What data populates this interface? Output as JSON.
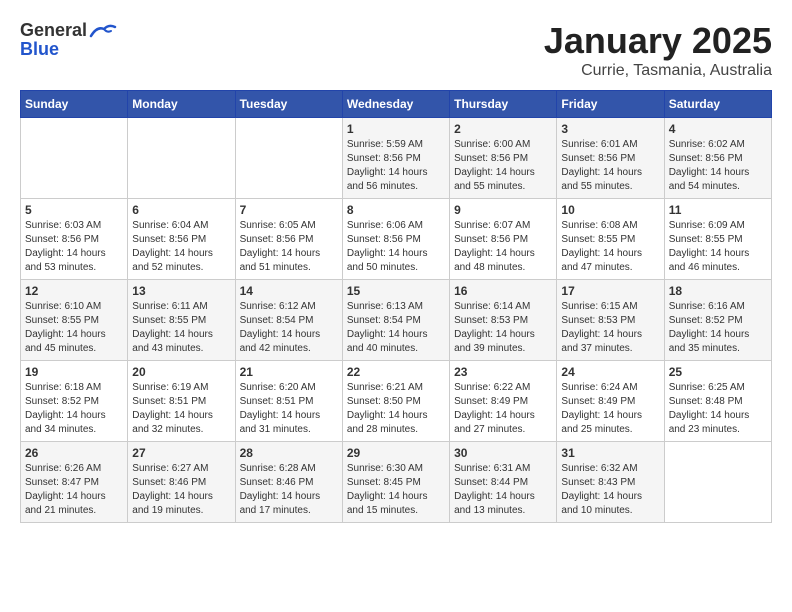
{
  "header": {
    "logo_general": "General",
    "logo_blue": "Blue",
    "title": "January 2025",
    "subtitle": "Currie, Tasmania, Australia"
  },
  "days_of_week": [
    "Sunday",
    "Monday",
    "Tuesday",
    "Wednesday",
    "Thursday",
    "Friday",
    "Saturday"
  ],
  "weeks": [
    [
      {
        "day": "",
        "info": ""
      },
      {
        "day": "",
        "info": ""
      },
      {
        "day": "",
        "info": ""
      },
      {
        "day": "1",
        "info": "Sunrise: 5:59 AM\nSunset: 8:56 PM\nDaylight: 14 hours\nand 56 minutes."
      },
      {
        "day": "2",
        "info": "Sunrise: 6:00 AM\nSunset: 8:56 PM\nDaylight: 14 hours\nand 55 minutes."
      },
      {
        "day": "3",
        "info": "Sunrise: 6:01 AM\nSunset: 8:56 PM\nDaylight: 14 hours\nand 55 minutes."
      },
      {
        "day": "4",
        "info": "Sunrise: 6:02 AM\nSunset: 8:56 PM\nDaylight: 14 hours\nand 54 minutes."
      }
    ],
    [
      {
        "day": "5",
        "info": "Sunrise: 6:03 AM\nSunset: 8:56 PM\nDaylight: 14 hours\nand 53 minutes."
      },
      {
        "day": "6",
        "info": "Sunrise: 6:04 AM\nSunset: 8:56 PM\nDaylight: 14 hours\nand 52 minutes."
      },
      {
        "day": "7",
        "info": "Sunrise: 6:05 AM\nSunset: 8:56 PM\nDaylight: 14 hours\nand 51 minutes."
      },
      {
        "day": "8",
        "info": "Sunrise: 6:06 AM\nSunset: 8:56 PM\nDaylight: 14 hours\nand 50 minutes."
      },
      {
        "day": "9",
        "info": "Sunrise: 6:07 AM\nSunset: 8:56 PM\nDaylight: 14 hours\nand 48 minutes."
      },
      {
        "day": "10",
        "info": "Sunrise: 6:08 AM\nSunset: 8:55 PM\nDaylight: 14 hours\nand 47 minutes."
      },
      {
        "day": "11",
        "info": "Sunrise: 6:09 AM\nSunset: 8:55 PM\nDaylight: 14 hours\nand 46 minutes."
      }
    ],
    [
      {
        "day": "12",
        "info": "Sunrise: 6:10 AM\nSunset: 8:55 PM\nDaylight: 14 hours\nand 45 minutes."
      },
      {
        "day": "13",
        "info": "Sunrise: 6:11 AM\nSunset: 8:55 PM\nDaylight: 14 hours\nand 43 minutes."
      },
      {
        "day": "14",
        "info": "Sunrise: 6:12 AM\nSunset: 8:54 PM\nDaylight: 14 hours\nand 42 minutes."
      },
      {
        "day": "15",
        "info": "Sunrise: 6:13 AM\nSunset: 8:54 PM\nDaylight: 14 hours\nand 40 minutes."
      },
      {
        "day": "16",
        "info": "Sunrise: 6:14 AM\nSunset: 8:53 PM\nDaylight: 14 hours\nand 39 minutes."
      },
      {
        "day": "17",
        "info": "Sunrise: 6:15 AM\nSunset: 8:53 PM\nDaylight: 14 hours\nand 37 minutes."
      },
      {
        "day": "18",
        "info": "Sunrise: 6:16 AM\nSunset: 8:52 PM\nDaylight: 14 hours\nand 35 minutes."
      }
    ],
    [
      {
        "day": "19",
        "info": "Sunrise: 6:18 AM\nSunset: 8:52 PM\nDaylight: 14 hours\nand 34 minutes."
      },
      {
        "day": "20",
        "info": "Sunrise: 6:19 AM\nSunset: 8:51 PM\nDaylight: 14 hours\nand 32 minutes."
      },
      {
        "day": "21",
        "info": "Sunrise: 6:20 AM\nSunset: 8:51 PM\nDaylight: 14 hours\nand 31 minutes."
      },
      {
        "day": "22",
        "info": "Sunrise: 6:21 AM\nSunset: 8:50 PM\nDaylight: 14 hours\nand 28 minutes."
      },
      {
        "day": "23",
        "info": "Sunrise: 6:22 AM\nSunset: 8:49 PM\nDaylight: 14 hours\nand 27 minutes."
      },
      {
        "day": "24",
        "info": "Sunrise: 6:24 AM\nSunset: 8:49 PM\nDaylight: 14 hours\nand 25 minutes."
      },
      {
        "day": "25",
        "info": "Sunrise: 6:25 AM\nSunset: 8:48 PM\nDaylight: 14 hours\nand 23 minutes."
      }
    ],
    [
      {
        "day": "26",
        "info": "Sunrise: 6:26 AM\nSunset: 8:47 PM\nDaylight: 14 hours\nand 21 minutes."
      },
      {
        "day": "27",
        "info": "Sunrise: 6:27 AM\nSunset: 8:46 PM\nDaylight: 14 hours\nand 19 minutes."
      },
      {
        "day": "28",
        "info": "Sunrise: 6:28 AM\nSunset: 8:46 PM\nDaylight: 14 hours\nand 17 minutes."
      },
      {
        "day": "29",
        "info": "Sunrise: 6:30 AM\nSunset: 8:45 PM\nDaylight: 14 hours\nand 15 minutes."
      },
      {
        "day": "30",
        "info": "Sunrise: 6:31 AM\nSunset: 8:44 PM\nDaylight: 14 hours\nand 13 minutes."
      },
      {
        "day": "31",
        "info": "Sunrise: 6:32 AM\nSunset: 8:43 PM\nDaylight: 14 hours\nand 10 minutes."
      },
      {
        "day": "",
        "info": ""
      }
    ]
  ]
}
